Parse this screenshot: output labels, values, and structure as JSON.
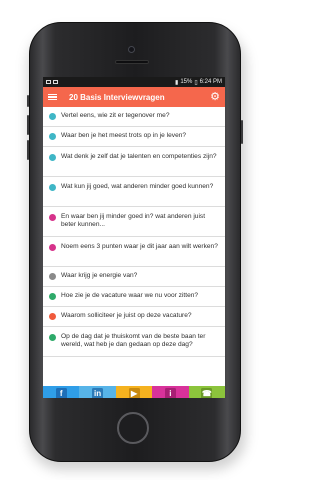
{
  "statusbar": {
    "battery": "15%",
    "time": "6:24 PM"
  },
  "app": {
    "title": "20 Basis Interviewvragen",
    "menu_icon": "hamburger-icon",
    "settings_icon": "gear-icon"
  },
  "questions": [
    {
      "text": "Vertel eens, wie zit er tegenover me?",
      "color": "#3fb6c6"
    },
    {
      "text": "Waar ben je het meest trots op in je leven?",
      "color": "#3fb6c6"
    },
    {
      "text": "Wat denk je zelf dat je talenten en competenties zijn?",
      "color": "#3fb6c6"
    },
    {
      "text": "Wat kun jij goed, wat anderen minder goed kunnen?",
      "color": "#3fb6c6"
    },
    {
      "text": "En waar ben jij minder goed in? wat anderen juist beter kunnen...",
      "color": "#d6338b"
    },
    {
      "text": "Noem eens 3 punten waar je dit jaar aan wilt werken?",
      "color": "#d6338b"
    },
    {
      "text": "Waar krijg je energie van?",
      "color": "#8a8a8a"
    },
    {
      "text": "Hoe zie je de vacature waar we nu voor zitten?",
      "color": "#2eaa6a"
    },
    {
      "text": "Waarom solliciteer je juist op deze vacature?",
      "color": "#f05a3c"
    },
    {
      "text": "Op de dag dat je thuiskomt van de beste baan ter wereld, wat heb je dan gedaan op deze dag?",
      "color": "#2eaa6a"
    }
  ],
  "bottom_nav": [
    {
      "label": "Facebook",
      "glyph": "f",
      "color": "#2f9ee8",
      "icon_bg": "#1e6fb8",
      "icon": "facebook-icon"
    },
    {
      "label": "LinkedIn",
      "glyph": "in",
      "color": "#57b4e8",
      "icon_bg": "#2b7ab8",
      "icon": "linkedin-icon"
    },
    {
      "label": "Media",
      "glyph": "▶",
      "color": "#f5b21f",
      "icon_bg": "#c98a0e",
      "icon": "media-icon"
    },
    {
      "label": "Info",
      "glyph": "i",
      "color": "#d8329a",
      "icon_bg": "#a81f74",
      "icon": "info-icon"
    },
    {
      "label": "Contact",
      "glyph": "☎",
      "color": "#8cc43c",
      "icon_bg": "#6a9a27",
      "icon": "phone-icon"
    }
  ]
}
